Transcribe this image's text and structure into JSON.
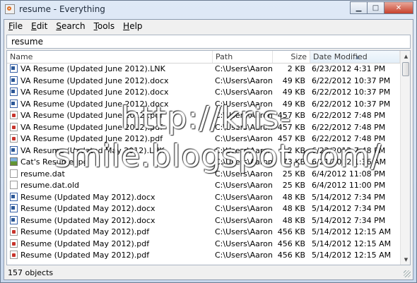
{
  "window": {
    "title": "resume - Everything"
  },
  "menu": [
    {
      "label": "File",
      "key": "F",
      "rest": "ile"
    },
    {
      "label": "Edit",
      "key": "E",
      "rest": "dit"
    },
    {
      "label": "Search",
      "key": "S",
      "rest": "earch"
    },
    {
      "label": "Tools",
      "key": "T",
      "rest": "ools"
    },
    {
      "label": "Help",
      "key": "H",
      "rest": "elp"
    }
  ],
  "search": {
    "value": "resume"
  },
  "columns": {
    "name": "Name",
    "path": "Path",
    "size": "Size",
    "date": "Date Modified"
  },
  "rows": [
    {
      "icon": "word",
      "name": "VA Resume (Updated June 2012).LNK",
      "path": "C:\\Users\\Aaron...",
      "size": "2 KB",
      "date": "6/23/2012 4:31 PM"
    },
    {
      "icon": "word",
      "name": "VA Resume (Updated June 2012).docx",
      "path": "C:\\Users\\Aaron...",
      "size": "49 KB",
      "date": "6/22/2012 10:37 PM"
    },
    {
      "icon": "word",
      "name": "VA Resume (Updated June 2012).docx",
      "path": "C:\\Users\\Aaron...",
      "size": "49 KB",
      "date": "6/22/2012 10:37 PM"
    },
    {
      "icon": "word",
      "name": "VA Resume (Updated June 2012).docx",
      "path": "C:\\Users\\Aaron...",
      "size": "49 KB",
      "date": "6/22/2012 10:37 PM"
    },
    {
      "icon": "pdf",
      "name": "VA Resume (Updated June 2012).pdf",
      "path": "C:\\Users\\Aaron...",
      "size": "457 KB",
      "date": "6/22/2012 7:48 PM"
    },
    {
      "icon": "pdf",
      "name": "VA Resume (Updated June 2012).pdf",
      "path": "C:\\Users\\Aaron...",
      "size": "457 KB",
      "date": "6/22/2012 7:48 PM"
    },
    {
      "icon": "pdf",
      "name": "VA Resume (Updated June 2012).pdf",
      "path": "C:\\Users\\Aaron...",
      "size": "457 KB",
      "date": "6/22/2012 7:48 PM"
    },
    {
      "icon": "word",
      "name": "VA Resume (Updated May 2012).LNK",
      "path": "C:\\Users\\Aaron...",
      "size": "2 KB",
      "date": "6/22/2012 7:48 PM"
    },
    {
      "icon": "image",
      "name": "Cat's Resume.jpg",
      "path": "C:\\Users\\Aaron...",
      "size": "73 KB",
      "date": "6/21/2012 1:36 AM"
    },
    {
      "icon": "blank",
      "name": "resume.dat",
      "path": "C:\\Users\\Aaron...",
      "size": "25 KB",
      "date": "6/4/2012 11:08 PM"
    },
    {
      "icon": "blank",
      "name": "resume.dat.old",
      "path": "C:\\Users\\Aaron...",
      "size": "25 KB",
      "date": "6/4/2012 11:00 PM"
    },
    {
      "icon": "word",
      "name": "Resume (Updated May 2012).docx",
      "path": "C:\\Users\\Aaron...",
      "size": "48 KB",
      "date": "5/14/2012 7:34 PM"
    },
    {
      "icon": "word",
      "name": "Resume (Updated May 2012).docx",
      "path": "C:\\Users\\Aaron...",
      "size": "48 KB",
      "date": "5/14/2012 7:34 PM"
    },
    {
      "icon": "word",
      "name": "Resume (Updated May 2012).docx",
      "path": "C:\\Users\\Aaron...",
      "size": "48 KB",
      "date": "5/14/2012 7:34 PM"
    },
    {
      "icon": "pdf",
      "name": "Resume (Updated May 2012).pdf",
      "path": "C:\\Users\\Aaron...",
      "size": "456 KB",
      "date": "5/14/2012 12:15 AM"
    },
    {
      "icon": "pdf",
      "name": "Resume (Updated May 2012).pdf",
      "path": "C:\\Users\\Aaron...",
      "size": "456 KB",
      "date": "5/14/2012 12:15 AM"
    },
    {
      "icon": "pdf",
      "name": "Resume (Updated May 2012).pdf",
      "path": "C:\\Users\\Aaron...",
      "size": "456 KB",
      "date": "5/14/2012 12:15 AM"
    }
  ],
  "status": {
    "text": "157 objects"
  },
  "watermark": {
    "line1": "http://kris-",
    "line2": "smile.blogspot.com/"
  }
}
